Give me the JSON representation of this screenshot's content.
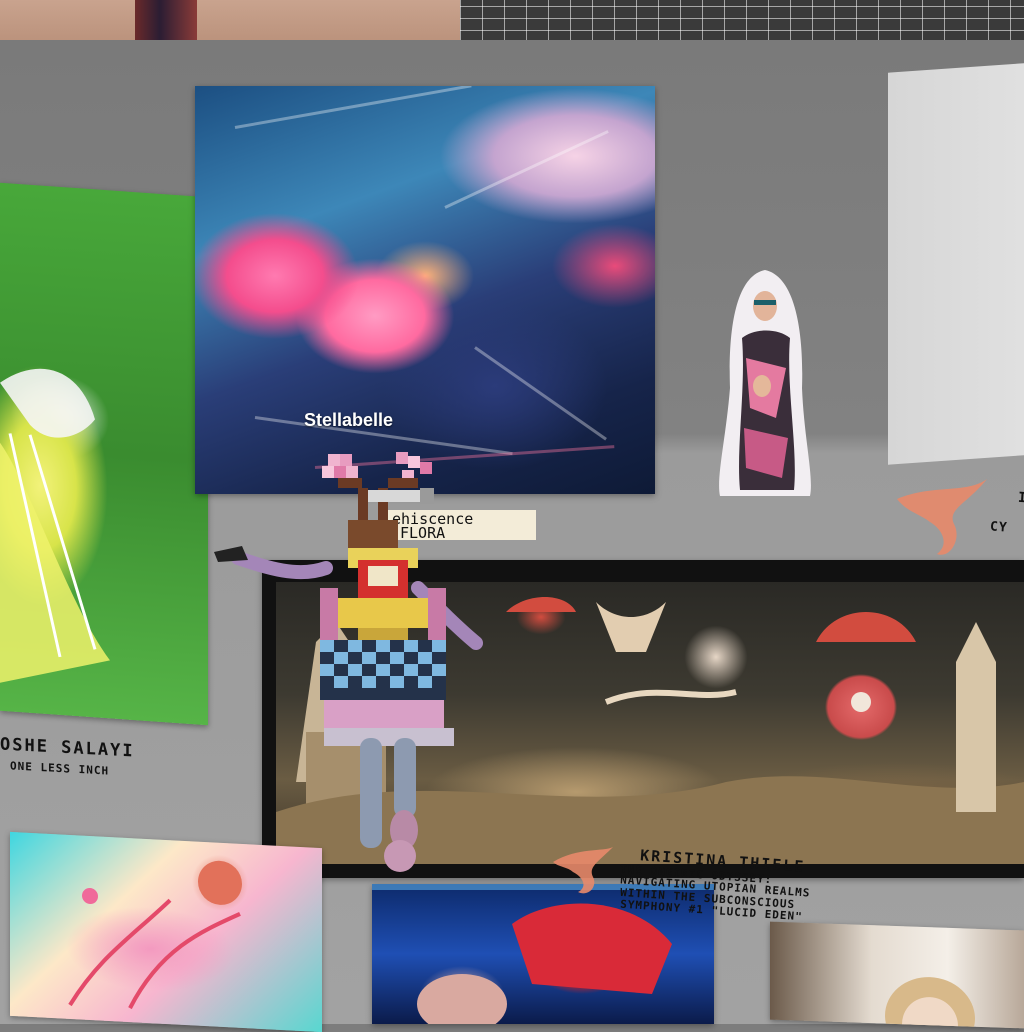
{
  "scene": {
    "avatar_nameplate": "Stellabelle",
    "sign_text": [
      "ehiscence",
      "FLORA"
    ]
  },
  "captions": {
    "moshe_name": "OSHE SALAYI",
    "moshe_title": "ONE LESS INCH",
    "kristina_name": "KRISTINA THIELE",
    "kristina_title_lines": [
      "THE ONEIRIC ODYSSEY:",
      "NAVIGATING UTOPIAN REALMS",
      "WITHIN THE SUBCONSCIOUS",
      "SYMPHONY #1 \"LUCID EDEN\""
    ],
    "right_fragment": "CY",
    "right_initial": "I"
  },
  "colors": {
    "wall": "#7d7d7d",
    "wall_lower": "#a2a2a2",
    "accent_pink": "#f44d8d",
    "flourish": "#e88a6a"
  }
}
